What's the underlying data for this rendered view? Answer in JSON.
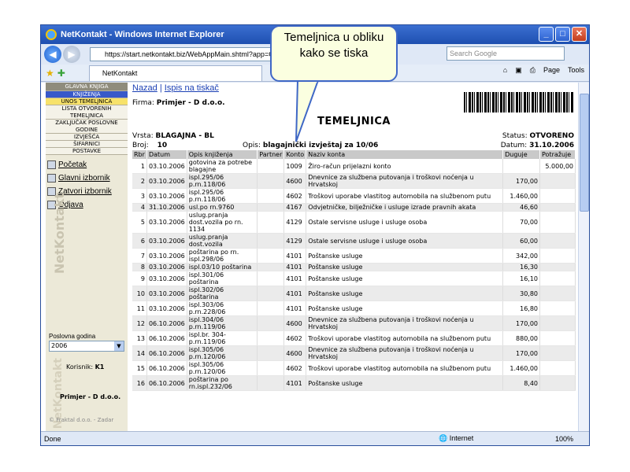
{
  "window": {
    "title": "NetKontakt - Windows Internet Explorer"
  },
  "browser": {
    "url": "https://start.netkontakt.biz/WebAppMain.shtml?app=GLK",
    "search_placeholder": "Search Google",
    "tab_title": "NetKontakt",
    "page_menu": "Page",
    "tools_menu": "Tools",
    "status_text": "Done",
    "zone": "Internet",
    "zoom": "100%"
  },
  "callout": {
    "text": "Temeljnica u obliku kako se tiska"
  },
  "sidebar": {
    "menu": [
      {
        "label": "GLAVNA KNJIGA",
        "style": "hdr"
      },
      {
        "label": "KNJIŽENJA",
        "style": "blue"
      },
      {
        "label": "UNOS TEMELJNICA",
        "style": "active"
      },
      {
        "label": "LISTA OTVORENIH TEMELJNICA",
        "style": "sub tall"
      },
      {
        "label": "ZAKLJUČAK POSLOVNE GODINE",
        "style": "sub tall"
      },
      {
        "label": "IZVJEŠĆA",
        "style": "sub"
      },
      {
        "label": "ŠIFARNICI",
        "style": "sub"
      },
      {
        "label": "POSTAVKE",
        "style": "sub"
      }
    ],
    "links": [
      {
        "label": "Početak",
        "icon": "home-icon"
      },
      {
        "label": "Glavni izbornik",
        "icon": "menu-icon"
      },
      {
        "label": "Zatvori izbornik",
        "icon": "close-menu-icon"
      },
      {
        "label": "Odjava",
        "icon": "lock-icon"
      }
    ],
    "watermark": "NetKontakt",
    "year_label": "Poslovna godina",
    "year_value": "2006",
    "user_label": "Korisnik:",
    "user_value": "K1",
    "company": "Primjer - D d.o.o.",
    "footer": "© Fraktal d.o.o. - Zadar"
  },
  "main": {
    "links": {
      "back": "Nazad",
      "print": "Ispis na tiskač",
      "separator": "|"
    },
    "firma_label": "Firma:",
    "firma_value": "Primjer - D d.o.o.",
    "title": "TEMELJNICA",
    "vrsta_label": "Vrsta:",
    "vrsta_value": "BLAGAJNA - BL",
    "status_label": "Status:",
    "status_value": "OTVORENO",
    "broj_label": "Broj:",
    "broj_value": "10",
    "opis_label": "Opis:",
    "opis_value": "blagajnički izvještaj za 10/06",
    "datum_label": "Datum:",
    "datum_value": "31.10.2006",
    "columns": [
      "Rbr",
      "Datum",
      "Opis knjiženja",
      "Partner",
      "Konto",
      "Naziv konta",
      "Duguje",
      "Potražuje"
    ],
    "rows": [
      [
        "1",
        "03.10.2006",
        "gotovina za potrebe blagajne",
        "",
        "1009",
        "Žiro-račun prijelazni konto",
        "",
        "5.000,00"
      ],
      [
        "2",
        "03.10.2006",
        "ispl.295/06 p.rn.118/06",
        "",
        "4600",
        "Dnevnice za službena putovanja i troškovi noćenja u Hrvatskoj",
        "170,00",
        ""
      ],
      [
        "3",
        "03.10.2006",
        "ispl.295/06 p.rn.118/06",
        "",
        "4602",
        "Troškovi uporabe vlastitog automobila na službenom putu",
        "1.460,00",
        ""
      ],
      [
        "4",
        "31.10.2006",
        "usl.po rn.9760",
        "",
        "4167",
        "Odvjetničke, bilježničke i usluge izrade pravnih akata",
        "46,60",
        ""
      ],
      [
        "5",
        "03.10.2006",
        "uslug.pranja dost.vozila po rn. 1134",
        "",
        "4129",
        "Ostale servisne usluge i usluge osoba",
        "70,00",
        ""
      ],
      [
        "6",
        "03.10.2006",
        "uslug.pranja dost.vozila",
        "",
        "4129",
        "Ostale servisne usluge i usluge osoba",
        "60,00",
        ""
      ],
      [
        "7",
        "03.10.2006",
        "poštarina po rn. ispl.298/06",
        "",
        "4101",
        "Poštanske usluge",
        "342,00",
        ""
      ],
      [
        "8",
        "03.10.2006",
        "ispl.03/10 poštarina",
        "",
        "4101",
        "Poštanske usluge",
        "16,30",
        ""
      ],
      [
        "9",
        "03.10.2006",
        "ispl.301/06 poštarina",
        "",
        "4101",
        "Poštanske usluge",
        "16,10",
        ""
      ],
      [
        "10",
        "03.10.2006",
        "ispl.302/06 poštarina",
        "",
        "4101",
        "Poštanske usluge",
        "30,80",
        ""
      ],
      [
        "11",
        "03.10.2006",
        "ispl.303/06 p.rn.228/06",
        "",
        "4101",
        "Poštanske usluge",
        "16,80",
        ""
      ],
      [
        "12",
        "06.10.2006",
        "ispl.304/06 p.rn.119/06",
        "",
        "4600",
        "Dnevnice za službena putovanja i troškovi noćenja u Hrvatskoj",
        "170,00",
        ""
      ],
      [
        "13",
        "06.10.2006",
        "ispl.br. 304-p.rn.119/06",
        "",
        "4602",
        "Troškovi uporabe vlastitog automobila na službenom putu",
        "880,00",
        ""
      ],
      [
        "14",
        "06.10.2006",
        "ispl.305/06 p.rn.120/06",
        "",
        "4600",
        "Dnevnice za službena putovanja i troškovi noćenja u Hrvatskoj",
        "170,00",
        ""
      ],
      [
        "15",
        "06.10.2006",
        "ispl.305/06 p.rn.120/06",
        "",
        "4602",
        "Troškovi uporabe vlastitog automobila na službenom putu",
        "1.460,00",
        ""
      ],
      [
        "16",
        "06.10.2006",
        "poštarina po rn.ispl.232/06",
        "",
        "4101",
        "Poštanske usluge",
        "8,40",
        ""
      ]
    ]
  }
}
